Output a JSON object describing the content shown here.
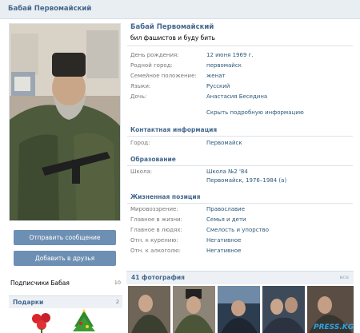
{
  "header": {
    "title": "Бабай Первомайский"
  },
  "profile": {
    "name": "Бабай Первомайский",
    "status": "бил фашистов и буду бить",
    "info": [
      {
        "label": "День рождения:",
        "value": "12 июня 1969 г."
      },
      {
        "label": "Родной город:",
        "value": "первомайск"
      },
      {
        "label": "Семейное положение:",
        "value": "женат"
      },
      {
        "label": "Языки:",
        "value": "Русский"
      },
      {
        "label": "Дочь:",
        "value": "Анастасия Беседина"
      }
    ],
    "show_more": "Скрыть подробную информацию"
  },
  "contacts": {
    "title": "Контактная информация",
    "rows": [
      {
        "label": "Город:",
        "value": "Первомайск"
      }
    ]
  },
  "education": {
    "title": "Образование",
    "rows": [
      {
        "label": "Школа:",
        "value": "Школа №2 '84",
        "value2": "Первомайск, 1976–1984 (а)"
      }
    ]
  },
  "life_position": {
    "title": "Жизненная позиция",
    "rows": [
      {
        "label": "Мировоззрение:",
        "value": "Православие"
      },
      {
        "label": "Главное в жизни:",
        "value": "Семья и дети"
      },
      {
        "label": "Главное в людях:",
        "value": "Смелость и упорство"
      },
      {
        "label": "Отн. к курению:",
        "value": "Негативное"
      },
      {
        "label": "Отн. к алкоголю:",
        "value": "Негативное"
      }
    ]
  },
  "actions": {
    "send_message": "Отправить сообщение",
    "add_friend": "Добавить в друзья"
  },
  "subscribers": {
    "label": "Подписчики Бабая",
    "count": "10"
  },
  "gifts": {
    "label": "Подарки",
    "count": "2"
  },
  "photos": {
    "label": "41 фотография",
    "all": "все"
  },
  "watermark": "PRESS.KG",
  "colors": {
    "link": "#2b587a",
    "header": "#45688e",
    "button": "#6d8fb3",
    "panel": "#edf1f5"
  }
}
